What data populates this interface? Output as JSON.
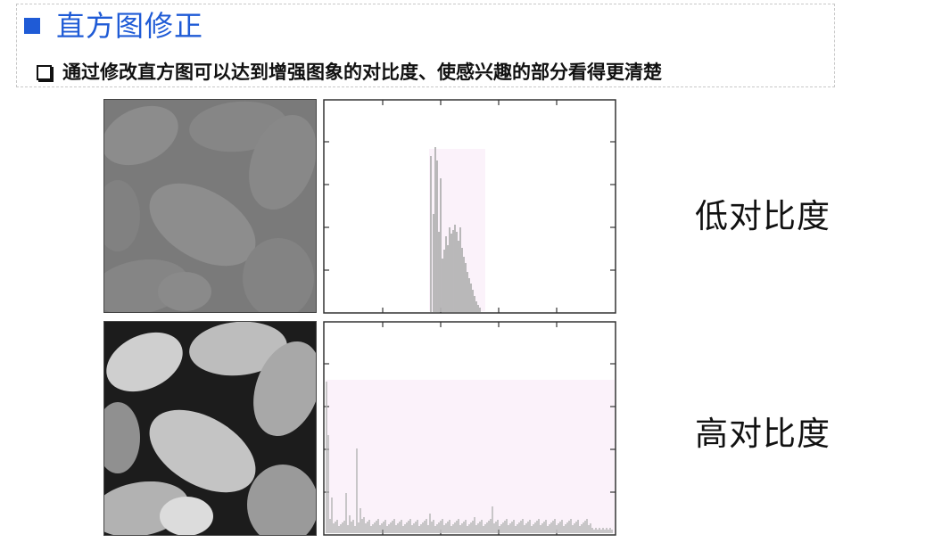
{
  "header": {
    "title": "直方图修正",
    "subtitle": "通过修改直方图可以达到增强图象的对比度、使感兴趣的部分看得更清楚",
    "title_bullet_icon": "square-bullet-icon",
    "subtitle_bullet_icon": "checkbox-bullet-icon",
    "accent_color": "#1f5bd6"
  },
  "rows": [
    {
      "label": "低对比度",
      "image_icon": "pollen-grains-low-contrast-photo",
      "histogram": {
        "type": "bar",
        "distribution": "narrow-mid-range",
        "bin_range": [
          0.36,
          0.55
        ]
      }
    },
    {
      "label": "高对比度",
      "image_icon": "pollen-grains-high-contrast-photo",
      "histogram": {
        "type": "bar",
        "distribution": "full-range-flat",
        "bin_range": [
          0.0,
          1.0
        ]
      }
    }
  ]
}
